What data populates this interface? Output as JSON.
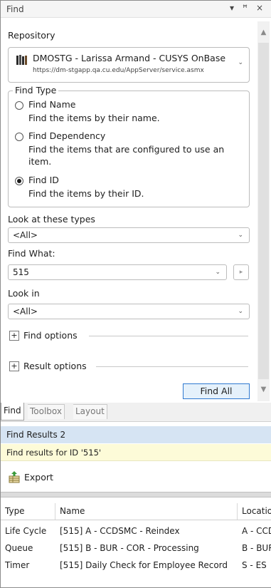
{
  "panel": {
    "title": "Find",
    "dropdown_glyph": "▾",
    "pin_glyph": "ꟸ",
    "close_glyph": "×"
  },
  "repository": {
    "label": "Repository",
    "name": "DMOSTG - Larissa Armand - CUSYS OnBase",
    "url": "https://dm-stgapp.qa.cu.edu/AppServer/service.asmx",
    "icon": "books-icon"
  },
  "find_type": {
    "legend": "Find Type",
    "options": [
      {
        "title": "Find Name",
        "desc": "Find the items by their name.",
        "selected": false
      },
      {
        "title": "Find Dependency",
        "desc": "Find the items that are configured to use an item.",
        "selected": false
      },
      {
        "title": "Find ID",
        "desc": "Find the items by their ID.",
        "selected": true
      }
    ]
  },
  "look_at_types": {
    "label": "Look at these types",
    "value": "<All>"
  },
  "find_what": {
    "label": "Find What:",
    "value": "515",
    "side_button_glyph": "▸"
  },
  "look_in": {
    "label": "Look in",
    "value": "<All>"
  },
  "find_options": {
    "label": "Find options",
    "toggle": "+"
  },
  "result_options": {
    "label": "Result options",
    "toggle": "+"
  },
  "find_all_button": "Find All",
  "tabs": [
    {
      "label": "Find",
      "active": true
    },
    {
      "label": "Toolbox",
      "active": false
    },
    {
      "label": "Layout",
      "active": false
    }
  ],
  "results": {
    "title": "Find Results 2",
    "banner": "Find results for ID '515'",
    "export_label": "Export",
    "columns": [
      "Type",
      "Name",
      "Location"
    ],
    "rows": [
      [
        "Life Cycle",
        "[515] A - CCDSMC - Reindex",
        "A - CCDSMC"
      ],
      [
        "Queue",
        "[515] B - BUR - COR - Processing",
        "B - BUR"
      ],
      [
        "Timer",
        "[515] Daily Check for Employee Record",
        "S - ES"
      ]
    ]
  },
  "colors": {
    "results_title_bg": "#d6e4f3",
    "banner_bg": "#fdfbd8",
    "find_all_border": "#2f79d0"
  }
}
